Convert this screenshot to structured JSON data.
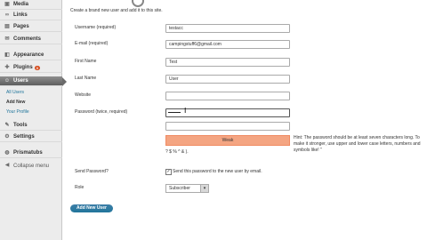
{
  "sidebar": {
    "items": [
      {
        "label": "Media",
        "icon": "media-icon",
        "glyph": "▣"
      },
      {
        "label": "Links",
        "icon": "link-icon",
        "glyph": "∞"
      },
      {
        "label": "Pages",
        "icon": "page-icon",
        "glyph": "▤"
      },
      {
        "label": "Comments",
        "icon": "comment-icon",
        "glyph": "✉"
      },
      {
        "label": "Appearance",
        "icon": "appearance-icon",
        "glyph": "◧"
      },
      {
        "label": "Plugins",
        "icon": "plugin-icon",
        "glyph": "✚"
      },
      {
        "label": "Users",
        "icon": "users-icon",
        "glyph": "☺"
      },
      {
        "label": "Tools",
        "icon": "tools-icon",
        "glyph": "✎"
      },
      {
        "label": "Settings",
        "icon": "settings-icon",
        "glyph": "⚙"
      },
      {
        "label": "Prismatubs",
        "icon": "prismatubs-icon",
        "glyph": "◍"
      },
      {
        "label": "Collapse menu",
        "icon": "collapse-icon",
        "glyph": "◀"
      }
    ],
    "plugins_badge": "3",
    "users_submenu": [
      "All Users",
      "Add New",
      "Your Profile"
    ]
  },
  "form": {
    "intro": "Create a brand new user and add it to this site.",
    "username_label": "Username (required)",
    "username_value": "testacc",
    "email_label": "E-mail (required)",
    "email_value": "campingstuff6@gmail.com",
    "firstname_label": "First Name",
    "firstname_value": "Test",
    "lastname_label": "Last Name",
    "lastname_value": "User",
    "website_label": "Website",
    "website_value": "",
    "password_label": "Password (twice, required)",
    "strength_label": "Weak",
    "hint_text": "Hint: The password should be at least seven characters long. To make it stronger, use upper and lower case letters, numbers and symbols like! \"",
    "hint_text2": "? $ % ^ & ).",
    "send_password_label": "Send Password?",
    "send_password_checkbox": "Send this password to the new user by email.",
    "role_label": "Role",
    "role_value": "Subscriber",
    "submit_label": "Add New User"
  }
}
